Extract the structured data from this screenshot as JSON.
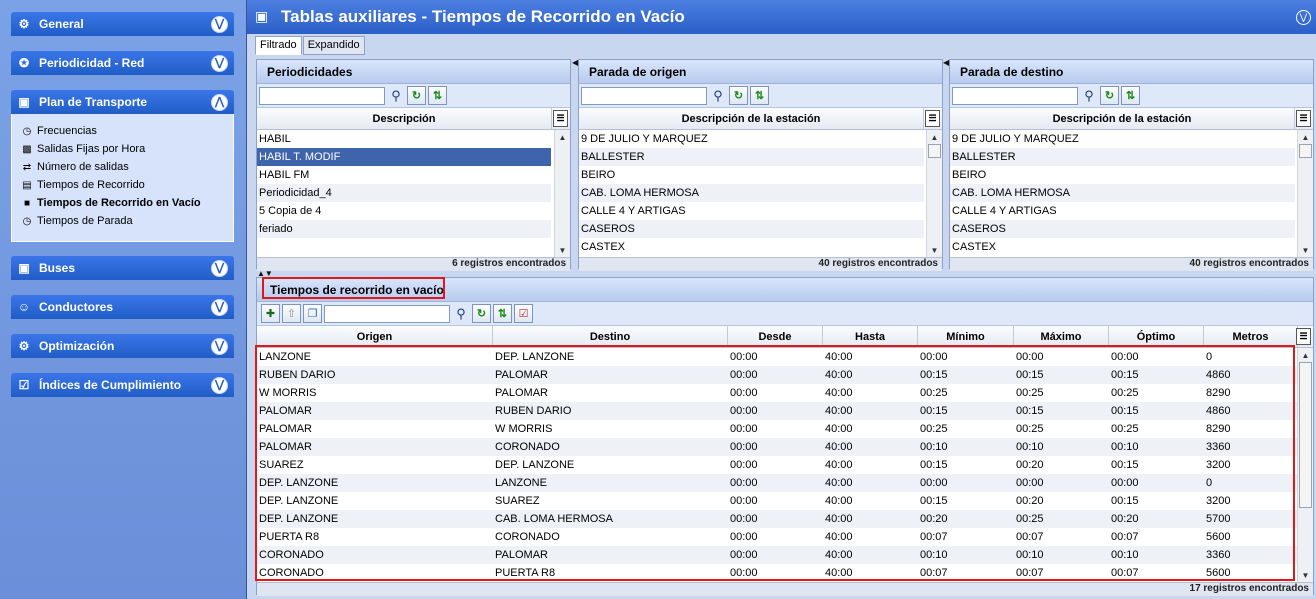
{
  "sidebar": {
    "groups": [
      {
        "label": "General",
        "icon": "general-icon",
        "collapsed": true
      },
      {
        "label": "Periodicidad - Red",
        "icon": "network-icon",
        "collapsed": true
      },
      {
        "label": "Plan de Transporte",
        "icon": "transport-plan-icon",
        "collapsed": false
      },
      {
        "label": "Buses",
        "icon": "bus-icon",
        "collapsed": true
      },
      {
        "label": "Conductores",
        "icon": "driver-icon",
        "collapsed": true
      },
      {
        "label": "Optimización",
        "icon": "optimization-icon",
        "collapsed": true
      },
      {
        "label": "Índices de Cumplimiento",
        "icon": "compliance-icon",
        "collapsed": true
      }
    ],
    "plan_items": [
      {
        "label": "Frecuencias",
        "icon": "frequency-icon",
        "active": false
      },
      {
        "label": "Salidas Fijas por Hora",
        "icon": "fixed-departures-icon",
        "active": false
      },
      {
        "label": "Número de salidas",
        "icon": "departures-count-icon",
        "active": false
      },
      {
        "label": "Tiempos de Recorrido",
        "icon": "travel-time-icon",
        "active": false
      },
      {
        "label": "Tiempos de Recorrido en Vacío",
        "icon": "empty-travel-time-icon",
        "active": true
      },
      {
        "label": "Tiempos de Parada",
        "icon": "stop-time-icon",
        "active": false
      }
    ]
  },
  "header": {
    "title": "Tablas auxiliares - Tiempos de Recorrido en Vacío"
  },
  "tabs": [
    {
      "label": "Filtrado",
      "active": true
    },
    {
      "label": "Expandido",
      "active": false
    }
  ],
  "periodicidades": {
    "title": "Periodicidades",
    "search_value": "",
    "column": "Descripción",
    "rows": [
      "HABIL",
      "HABIL T. MODIF",
      "HABIL FM",
      "Periodicidad_4",
      "5 Copia de 4",
      "feriado"
    ],
    "selected_index": 1,
    "footer": "6 registros encontrados"
  },
  "origen": {
    "title": "Parada de origen",
    "search_value": "",
    "column": "Descripción de la estación",
    "rows": [
      "9 DE JULIO Y MARQUEZ",
      "BALLESTER",
      "BEIRO",
      "CAB. LOMA HERMOSA",
      "CALLE 4 Y ARTIGAS",
      "CASEROS",
      "CASTEX"
    ],
    "footer": "40 registros encontrados"
  },
  "destino": {
    "title": "Parada de destino",
    "search_value": "",
    "column": "Descripción de la estación",
    "rows": [
      "9 DE JULIO Y MARQUEZ",
      "BALLESTER",
      "BEIRO",
      "CAB. LOMA HERMOSA",
      "CALLE 4 Y ARTIGAS",
      "CASEROS",
      "CASTEX"
    ],
    "footer": "40 registros encontrados"
  },
  "tiempos": {
    "title": "Tiempos de recorrido en vacío",
    "search_value": "",
    "columns": [
      "Origen",
      "Destino",
      "Desde",
      "Hasta",
      "Mínimo",
      "Máximo",
      "Óptimo",
      "Metros"
    ],
    "rows": [
      [
        "LANZONE",
        "DEP. LANZONE",
        "00:00",
        "40:00",
        "00:00",
        "00:00",
        "00:00",
        "0"
      ],
      [
        "RUBEN DARIO",
        "PALOMAR",
        "00:00",
        "40:00",
        "00:15",
        "00:15",
        "00:15",
        "4860"
      ],
      [
        "W MORRIS",
        "PALOMAR",
        "00:00",
        "40:00",
        "00:25",
        "00:25",
        "00:25",
        "8290"
      ],
      [
        "PALOMAR",
        "RUBEN DARIO",
        "00:00",
        "40:00",
        "00:15",
        "00:15",
        "00:15",
        "4860"
      ],
      [
        "PALOMAR",
        "W MORRIS",
        "00:00",
        "40:00",
        "00:25",
        "00:25",
        "00:25",
        "8290"
      ],
      [
        "PALOMAR",
        "CORONADO",
        "00:00",
        "40:00",
        "00:10",
        "00:10",
        "00:10",
        "3360"
      ],
      [
        "SUAREZ",
        "DEP. LANZONE",
        "00:00",
        "40:00",
        "00:15",
        "00:20",
        "00:15",
        "3200"
      ],
      [
        "DEP. LANZONE",
        "LANZONE",
        "00:00",
        "40:00",
        "00:00",
        "00:00",
        "00:00",
        "0"
      ],
      [
        "DEP. LANZONE",
        "SUAREZ",
        "00:00",
        "40:00",
        "00:15",
        "00:20",
        "00:15",
        "3200"
      ],
      [
        "DEP. LANZONE",
        "CAB. LOMA HERMOSA",
        "00:00",
        "40:00",
        "00:20",
        "00:25",
        "00:20",
        "5700"
      ],
      [
        "PUERTA R8",
        "CORONADO",
        "00:00",
        "40:00",
        "00:07",
        "00:07",
        "00:07",
        "5600"
      ],
      [
        "CORONADO",
        "PALOMAR",
        "00:00",
        "40:00",
        "00:10",
        "00:10",
        "00:10",
        "3360"
      ],
      [
        "CORONADO",
        "PUERTA R8",
        "00:00",
        "40:00",
        "00:07",
        "00:07",
        "00:07",
        "5600"
      ]
    ],
    "footer": "17 registros encontrados"
  }
}
